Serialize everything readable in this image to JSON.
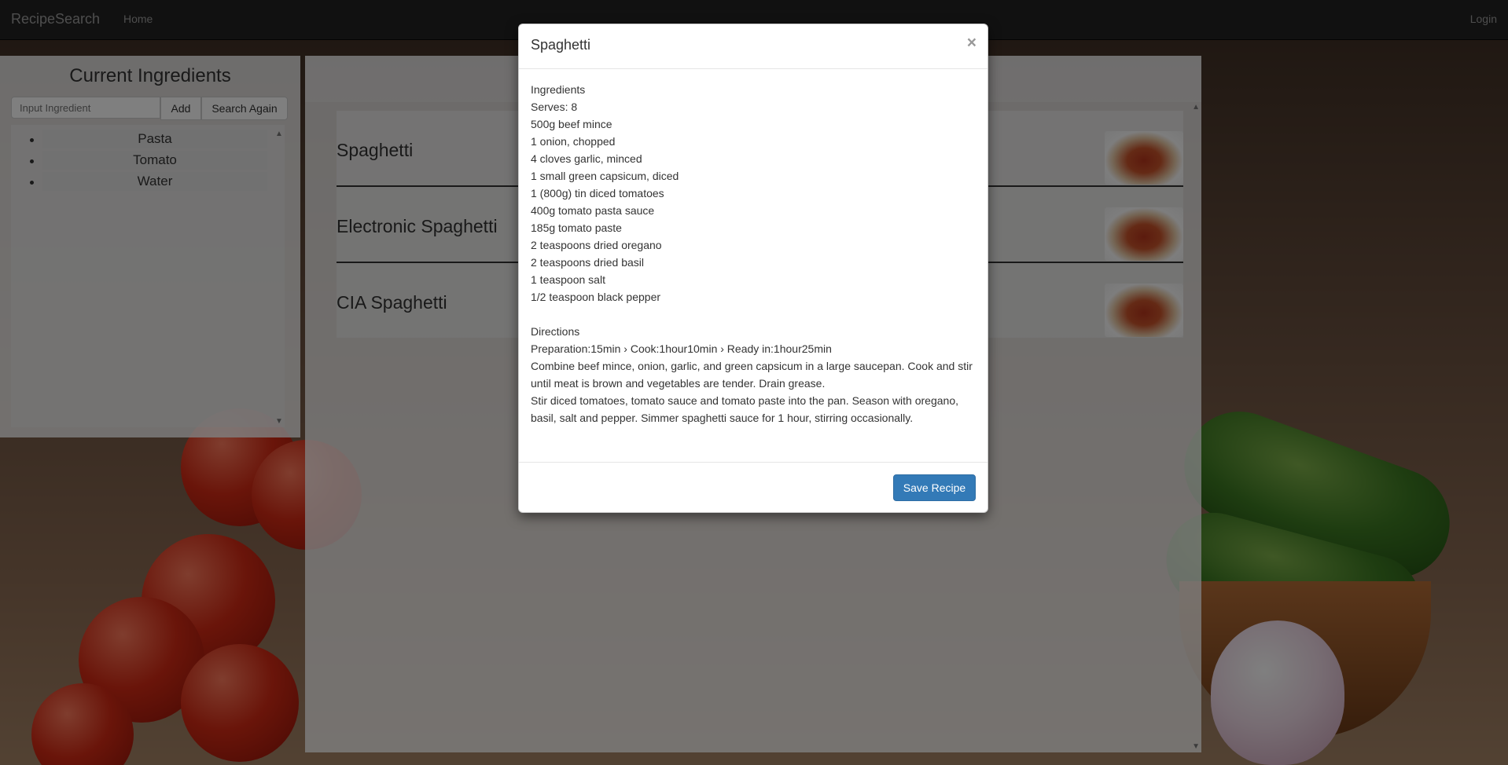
{
  "navbar": {
    "brand": "RecipeSearch",
    "home": "Home",
    "login": "Login"
  },
  "ingredients_panel": {
    "title": "Current Ingredients",
    "input_placeholder": "Input Ingredient",
    "add_label": "Add",
    "search_again_label": "Search Again",
    "items": [
      "Pasta",
      "Tomato",
      "Water"
    ]
  },
  "results": {
    "recipes": [
      {
        "title": "Spaghetti"
      },
      {
        "title": "Electronic Spaghetti"
      },
      {
        "title": "CIA Spaghetti"
      }
    ]
  },
  "modal": {
    "title": "Spaghetti",
    "close": "×",
    "ingredients_heading": "Ingredients",
    "serves": "Serves: 8",
    "ingredients": [
      "500g beef mince",
      "1 onion, chopped",
      "4 cloves garlic, minced",
      "1 small green capsicum, diced",
      "1 (800g) tin diced tomatoes",
      "400g tomato pasta sauce",
      "185g tomato paste",
      "2 teaspoons dried oregano",
      "2 teaspoons dried basil",
      "1 teaspoon salt",
      "1/2 teaspoon black pepper"
    ],
    "directions_heading": "Directions",
    "timing": "Preparation:15min › Cook:1hour10min › Ready in:1hour25min",
    "steps": [
      "Combine beef mince, onion, garlic, and green capsicum in a large saucepan. Cook and stir until meat is brown and vegetables are tender. Drain grease.",
      "Stir diced tomatoes, tomato sauce and tomato paste into the pan. Season with oregano, basil, salt and pepper. Simmer spaghetti sauce for 1 hour, stirring occasionally."
    ],
    "save_label": "Save Recipe"
  }
}
